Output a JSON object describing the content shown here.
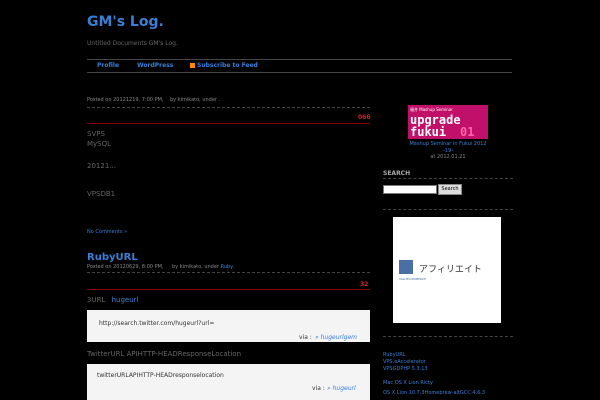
{
  "header": {
    "title": "GM's Log.",
    "description": "Untitled Documents GM's Log."
  },
  "nav": {
    "profile": "Profile",
    "wordpress": "WordPress",
    "subscribe": "Subscribe to Feed"
  },
  "post1": {
    "meta": "Posted on 20121219, 7:00 PM,",
    "meta_by": "by kimikato, under .",
    "comment_count": "066",
    "lines": [
      "SVPS",
      "MySQL",
      "20121...",
      "VPSDB1"
    ],
    "comments_link": "No Comments »"
  },
  "post2": {
    "title": "RubyURL",
    "meta": "Posted on 20120629, 8:00 PM,",
    "meta_by": "by kimikato, under",
    "meta_cat": "Ruby.",
    "comment_count": "32",
    "intro": "3URL",
    "intro_link": "hugeurl",
    "code1": "http://search.twitter.com/hugeurl?url=",
    "code1_via_label": "via :",
    "code1_via_link": "» hugeurlgem",
    "para2": "TwitterURL APIHTTP-HEADResponseLocation",
    "code2": "twitterURLAPIHTTP-HEADresponselocation",
    "code2_via_label": "via :",
    "code2_via_link": "» hugeurl"
  },
  "sidebar": {
    "banner": {
      "top_text": "福井 Mashup Seminar",
      "line1": "upgrade",
      "line2": "fukui",
      "line2_accent": "01"
    },
    "banner_caption": "Mashup Seminar in Fukui 2012",
    "banner_caption2": "-19-",
    "banner_date": "at 2012.01.21",
    "search_heading": "SEARCH",
    "search_button": "Search",
    "ad_text": "アフィリエイト",
    "ad_sub": "VALUECOMMERCE",
    "links": [
      "RubyURL",
      "VPS.eAccelerator",
      "VPSGDPHP 5.3.13",
      "Mac OS X Lion Ricty",
      "OS X Lion 10.7.3Homebrew-altGCC 4.6.3"
    ]
  },
  "colors": {
    "link": "#3a7fd6",
    "comment_red": "#d22",
    "banner_magenta": "#c0106a"
  }
}
